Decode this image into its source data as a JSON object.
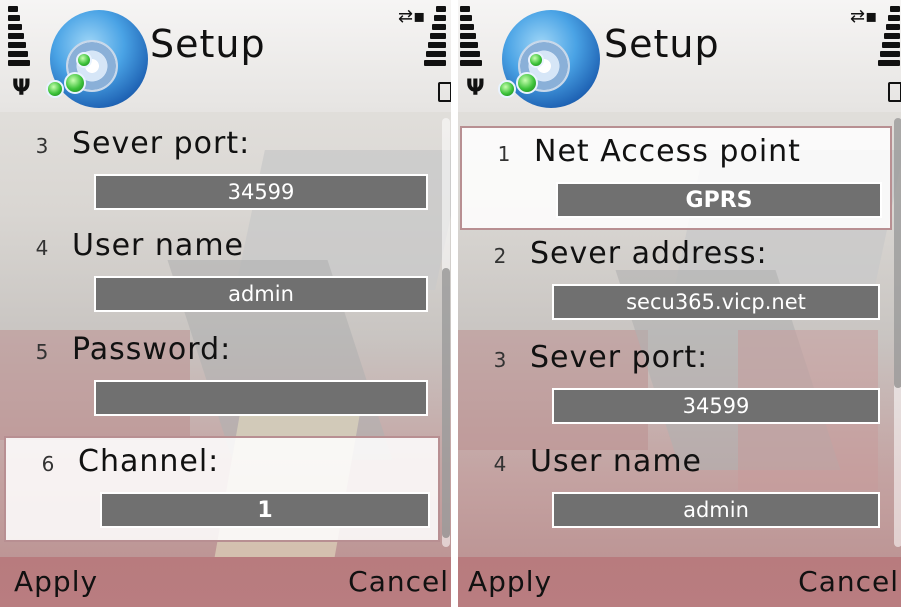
{
  "left": {
    "title": "Setup",
    "items": [
      {
        "num": "3",
        "label": "Sever port:",
        "value": "34599",
        "selected": false
      },
      {
        "num": "4",
        "label": "User name",
        "value": "admin",
        "selected": false
      },
      {
        "num": "5",
        "label": "Password:",
        "value": "",
        "selected": false
      },
      {
        "num": "6",
        "label": "Channel:",
        "value": "1",
        "selected": true
      }
    ],
    "softkeys": {
      "left": "Apply",
      "right": "Cancel"
    }
  },
  "right": {
    "title": "Setup",
    "items": [
      {
        "num": "1",
        "label": "Net Access point",
        "value": "GPRS",
        "selected": true
      },
      {
        "num": "2",
        "label": "Sever address:",
        "value": "secu365.vicp.net",
        "selected": false
      },
      {
        "num": "3",
        "label": "Sever port:",
        "value": "34599",
        "selected": false
      },
      {
        "num": "4",
        "label": "User name",
        "value": "admin",
        "selected": false
      }
    ],
    "softkeys": {
      "left": "Apply",
      "right": "Cancel"
    }
  },
  "icons": {
    "logo": "setup-logo-icon",
    "signal": "signal-strength-icon",
    "battery": "battery-icon",
    "gprs": "gprs-connection-icon"
  },
  "colors": {
    "field_bg": "#707070",
    "softkey_bar": "#b87b7e",
    "selection_border": "#b88f92"
  }
}
